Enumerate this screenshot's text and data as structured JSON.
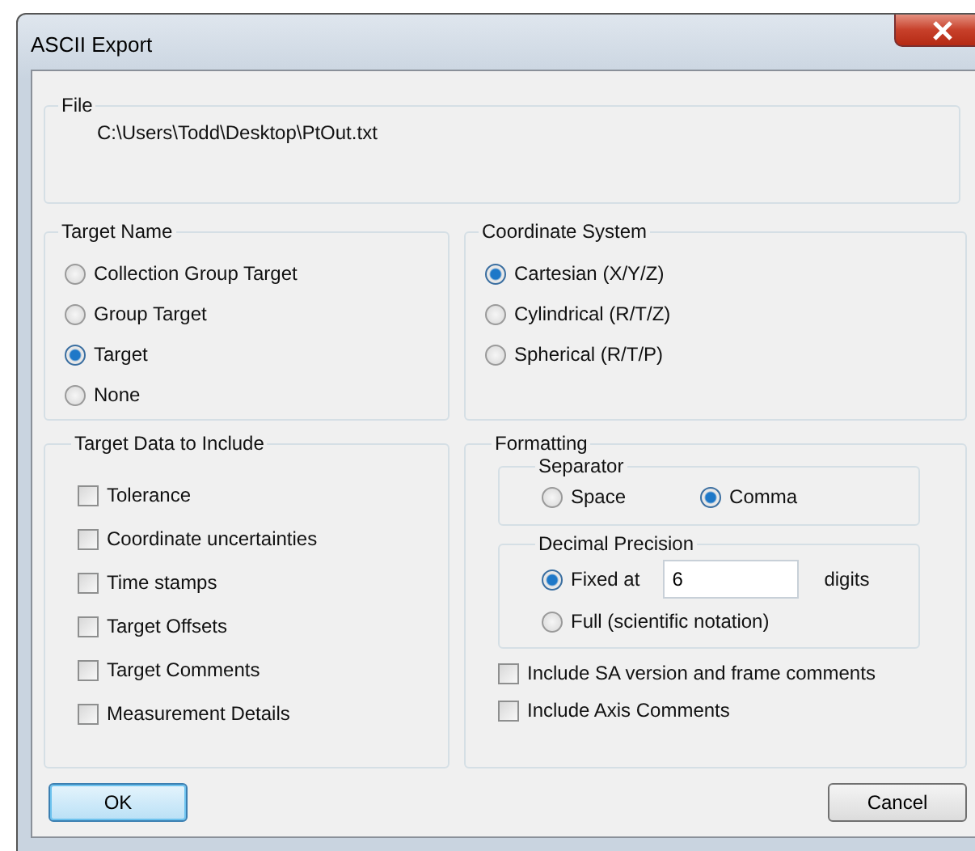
{
  "window": {
    "title": "ASCII Export"
  },
  "file": {
    "label": "File",
    "path": "C:\\Users\\Todd\\Desktop\\PtOut.txt"
  },
  "target_name": {
    "label": "Target Name",
    "options": [
      {
        "label": "Collection  Group  Target",
        "selected": false
      },
      {
        "label": "Group  Target",
        "selected": false
      },
      {
        "label": "Target",
        "selected": true
      },
      {
        "label": "None",
        "selected": false
      }
    ]
  },
  "coordinate_system": {
    "label": "Coordinate System",
    "options": [
      {
        "label": "Cartesian (X/Y/Z)",
        "selected": true
      },
      {
        "label": "Cylindrical (R/T/Z)",
        "selected": false
      },
      {
        "label": "Spherical (R/T/P)",
        "selected": false
      }
    ]
  },
  "target_data": {
    "label": "Target Data to Include",
    "items": [
      {
        "label": "Tolerance",
        "checked": false
      },
      {
        "label": "Coordinate uncertainties",
        "checked": false
      },
      {
        "label": "Time stamps",
        "checked": false
      },
      {
        "label": "Target Offsets",
        "checked": false
      },
      {
        "label": "Target Comments",
        "checked": false
      },
      {
        "label": "Measurement Details",
        "checked": false
      }
    ]
  },
  "formatting": {
    "label": "Formatting",
    "separator": {
      "label": "Separator",
      "options": [
        {
          "label": "Space",
          "selected": false
        },
        {
          "label": "Comma",
          "selected": true
        }
      ]
    },
    "decimal_precision": {
      "label": "Decimal Precision",
      "options": [
        {
          "label": "Fixed at",
          "selected": true,
          "value": "6",
          "unit": "digits"
        },
        {
          "label": "Full (scientific notation)",
          "selected": false
        }
      ]
    },
    "options": [
      {
        "label": "Include SA version and frame comments",
        "checked": false
      },
      {
        "label": "Include Axis Comments",
        "checked": false
      }
    ]
  },
  "buttons": [
    {
      "label": "OK",
      "default": true
    },
    {
      "label": "Cancel",
      "default": false
    }
  ]
}
